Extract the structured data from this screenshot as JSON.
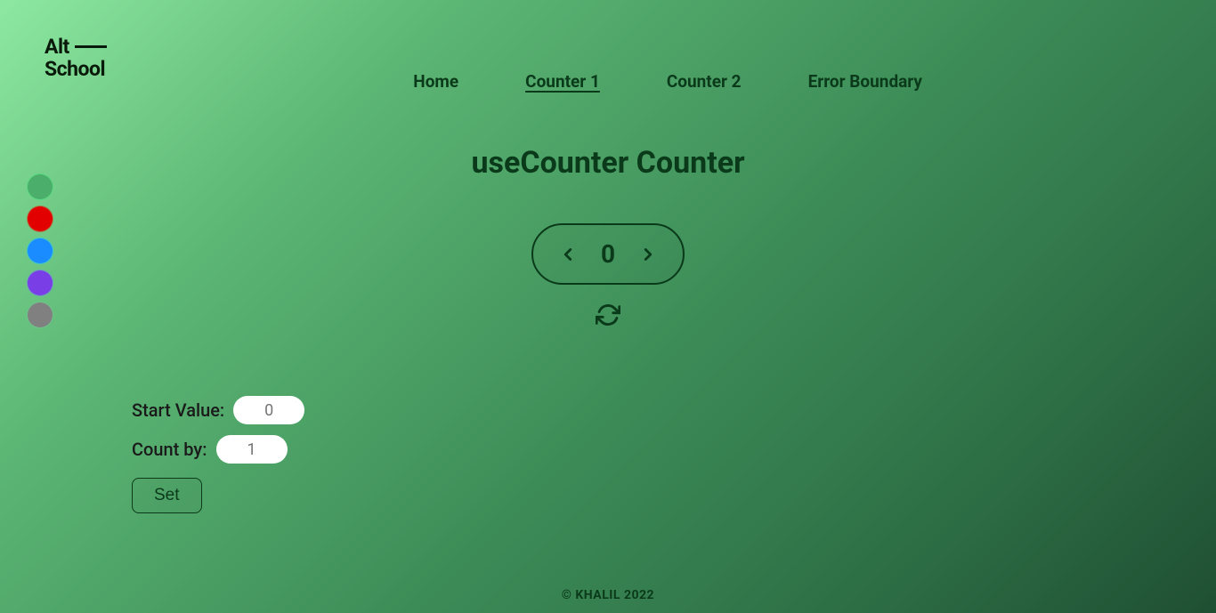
{
  "logo": {
    "line1": "Alt",
    "line2": "School"
  },
  "nav": {
    "items": [
      {
        "label": "Home",
        "active": false
      },
      {
        "label": "Counter 1",
        "active": true
      },
      {
        "label": "Counter 2",
        "active": false
      },
      {
        "label": "Error Boundary",
        "active": false
      }
    ]
  },
  "page": {
    "title": "useCounter Counter"
  },
  "counter": {
    "value": "0"
  },
  "color_swatches": [
    {
      "name": "green",
      "color": "#4cae6b"
    },
    {
      "name": "red",
      "color": "#e30000"
    },
    {
      "name": "blue",
      "color": "#1a8cff"
    },
    {
      "name": "purple",
      "color": "#7a3ee6"
    },
    {
      "name": "gray",
      "color": "#808080"
    }
  ],
  "form": {
    "start_value_label": "Start Value:",
    "start_value_placeholder": "0",
    "count_by_label": "Count by:",
    "count_by_placeholder": "1",
    "set_label": "Set"
  },
  "footer": {
    "text": "© KHALIL 2022"
  }
}
